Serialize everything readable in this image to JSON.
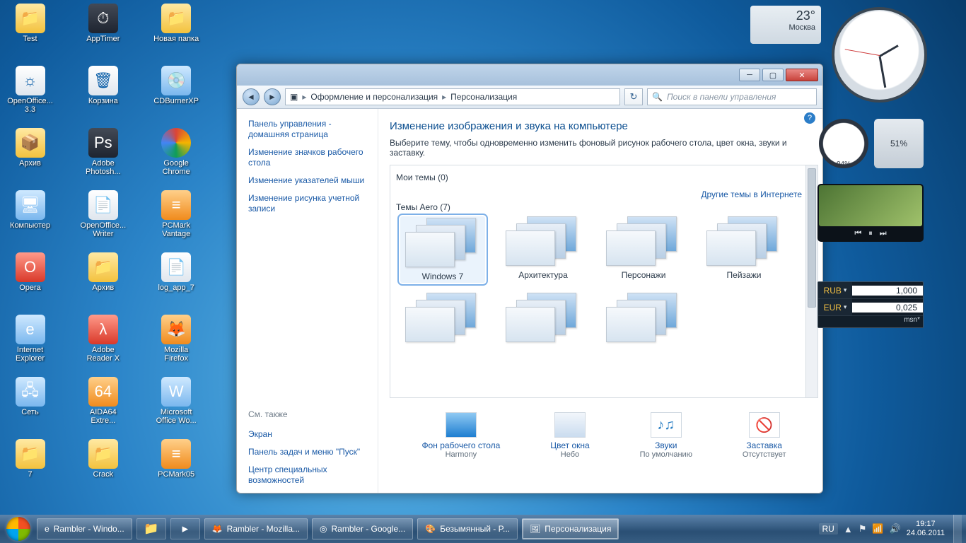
{
  "desktop_icons": [
    {
      "label": "Test",
      "cls": "folder",
      "g": "📁"
    },
    {
      "label": "OpenOffice... 3.3",
      "cls": "white",
      "g": "☼"
    },
    {
      "label": "Архив",
      "cls": "folder",
      "g": "📦"
    },
    {
      "label": "Компьютер",
      "cls": "blue",
      "g": "🖥"
    },
    {
      "label": "Opera",
      "cls": "red",
      "g": "O"
    },
    {
      "label": "Internet Explorer",
      "cls": "blue",
      "g": "e"
    },
    {
      "label": "Сеть",
      "cls": "blue",
      "g": "🖧"
    },
    {
      "label": "7",
      "cls": "folder",
      "g": "📁"
    },
    {
      "label": "AppTimer",
      "cls": "dark",
      "g": "⏱"
    },
    {
      "label": "Корзина",
      "cls": "white",
      "g": "🗑"
    },
    {
      "label": "Adobe Photosh...",
      "cls": "dark",
      "g": "Ps"
    },
    {
      "label": "OpenOffice... Writer",
      "cls": "white",
      "g": "📄"
    },
    {
      "label": "Архив",
      "cls": "folder",
      "g": "📁"
    },
    {
      "label": "Adobe Reader X",
      "cls": "red",
      "g": "λ"
    },
    {
      "label": "AIDA64 Extre...",
      "cls": "orange",
      "g": "64"
    },
    {
      "label": "Crack",
      "cls": "folder",
      "g": "📁"
    },
    {
      "label": "Новая папка",
      "cls": "folder",
      "g": "📁"
    },
    {
      "label": "CDBurnerXP",
      "cls": "blue",
      "g": "💿"
    },
    {
      "label": "Google Chrome",
      "cls": "green",
      "g": ""
    },
    {
      "label": "PCMark Vantage",
      "cls": "orange",
      "g": "≡"
    },
    {
      "label": "log_app_7",
      "cls": "white",
      "g": "📄"
    },
    {
      "label": "Mozilla Firefox",
      "cls": "orange",
      "g": "🦊"
    },
    {
      "label": "Microsoft Office Wo...",
      "cls": "blue",
      "g": "W"
    },
    {
      "label": "PCMark05",
      "cls": "orange",
      "g": "≡"
    }
  ],
  "window": {
    "breadcrumb1": "Оформление и персонализация",
    "breadcrumb2": "Персонализация",
    "search_placeholder": "Поиск в панели управления",
    "title": "Изменение изображения и звука на компьютере",
    "subtitle": "Выберите тему, чтобы одновременно изменить фоновый рисунок рабочего стола, цвет окна, звуки и заставку.",
    "my_themes": "Мои темы (0)",
    "online": "Другие темы в Интернете",
    "aero": "Темы Aero (7)"
  },
  "sidebar_links": [
    "Панель управления - домашняя страница",
    "Изменение значков рабочего стола",
    "Изменение указателей мыши",
    "Изменение рисунка учетной записи"
  ],
  "sidebar_seealso_label": "См. также",
  "sidebar_seealso": [
    "Экран",
    "Панель задач и меню \"Пуск\"",
    "Центр специальных возможностей"
  ],
  "themes": [
    {
      "label": "Windows 7",
      "sel": true
    },
    {
      "label": "Архитектура"
    },
    {
      "label": "Персонажи"
    },
    {
      "label": "Пейзажи"
    }
  ],
  "footer": [
    {
      "t": "Фон рабочего стола",
      "s": "Harmony",
      "cls": "fi-bg",
      "g": ""
    },
    {
      "t": "Цвет окна",
      "s": "Небо",
      "cls": "fi-col",
      "g": ""
    },
    {
      "t": "Звуки",
      "s": "По умолчанию",
      "cls": "fi-snd",
      "g": "♪♫"
    },
    {
      "t": "Заставка",
      "s": "Отсутствует",
      "cls": "fi-sav",
      "g": "🚫"
    }
  ],
  "gadgets": {
    "weather": {
      "temp": "23°",
      "city": "Москва"
    },
    "meter1": "04%",
    "meter2": "51%",
    "currency": [
      {
        "cur": "RUB",
        "val": "1,000"
      },
      {
        "cur": "EUR",
        "val": "0,025"
      }
    ],
    "currency_src": "msn*"
  },
  "taskbar": {
    "tasks": [
      {
        "label": "Rambler - Windo...",
        "g": "e"
      },
      {
        "label": "",
        "g": "📁",
        "pin": true
      },
      {
        "label": "",
        "g": "▸",
        "pin": true
      },
      {
        "label": "Rambler - Mozilla...",
        "g": "🦊"
      },
      {
        "label": "Rambler - Google...",
        "g": "◎"
      },
      {
        "label": "Безымянный - P...",
        "g": "🎨"
      },
      {
        "label": "Персонализация",
        "g": "🖼",
        "active": true
      }
    ],
    "lang": "RU",
    "time": "19:17",
    "date": "24.06.2011"
  }
}
